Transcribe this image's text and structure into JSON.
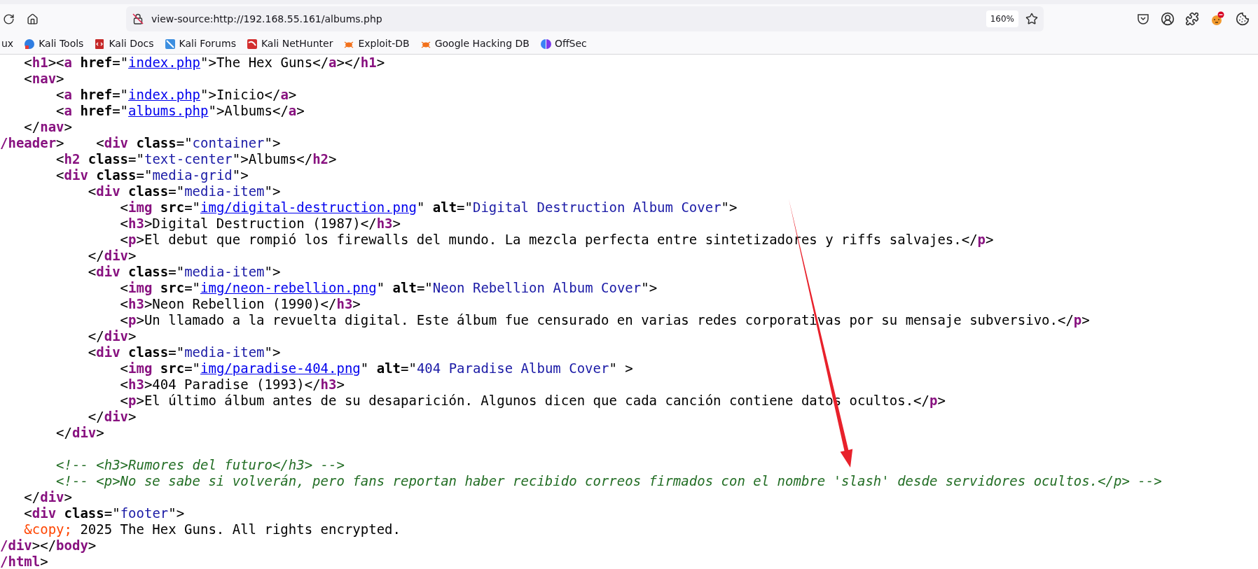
{
  "toolbar": {
    "url": "view-source:http://192.168.55.161/albums.php",
    "zoom": "160%"
  },
  "bookmarks": [
    {
      "label": "ux",
      "kind": "partial"
    },
    {
      "label": "Kali Tools",
      "kind": "site"
    },
    {
      "label": "Kali Docs",
      "kind": "site"
    },
    {
      "label": "Kali Forums",
      "kind": "site"
    },
    {
      "label": "Kali NetHunter",
      "kind": "site"
    },
    {
      "label": "Exploit-DB",
      "kind": "site"
    },
    {
      "label": "Google Hacking DB",
      "kind": "site"
    },
    {
      "label": "OffSec",
      "kind": "site"
    }
  ],
  "source": {
    "lines": [
      {
        "tokens": [
          {
            "kind": "plain",
            "text": "   <"
          },
          {
            "kind": "tag",
            "text": "h1"
          },
          {
            "kind": "plain",
            "text": "><"
          },
          {
            "kind": "tag",
            "text": "a"
          },
          {
            "kind": "attr",
            "text": " href"
          },
          {
            "kind": "plain",
            "text": "=\""
          },
          {
            "kind": "link",
            "text": "index.php"
          },
          {
            "kind": "plain",
            "text": "\">The Hex Guns</"
          },
          {
            "kind": "tag",
            "text": "a"
          },
          {
            "kind": "plain",
            "text": "></"
          },
          {
            "kind": "tag",
            "text": "h1"
          },
          {
            "kind": "plain",
            "text": ">"
          }
        ]
      },
      {
        "tokens": [
          {
            "kind": "plain",
            "text": "   <"
          },
          {
            "kind": "tag",
            "text": "nav"
          },
          {
            "kind": "plain",
            "text": ">"
          }
        ]
      },
      {
        "tokens": [
          {
            "kind": "plain",
            "text": "       <"
          },
          {
            "kind": "tag",
            "text": "a"
          },
          {
            "kind": "attr",
            "text": " href"
          },
          {
            "kind": "plain",
            "text": "=\""
          },
          {
            "kind": "link",
            "text": "index.php"
          },
          {
            "kind": "plain",
            "text": "\">Inicio</"
          },
          {
            "kind": "tag",
            "text": "a"
          },
          {
            "kind": "plain",
            "text": ">"
          }
        ]
      },
      {
        "tokens": [
          {
            "kind": "plain",
            "text": "       <"
          },
          {
            "kind": "tag",
            "text": "a"
          },
          {
            "kind": "attr",
            "text": " href"
          },
          {
            "kind": "plain",
            "text": "=\""
          },
          {
            "kind": "link",
            "text": "albums.php"
          },
          {
            "kind": "plain",
            "text": "\">Albums</"
          },
          {
            "kind": "tag",
            "text": "a"
          },
          {
            "kind": "plain",
            "text": ">"
          }
        ]
      },
      {
        "tokens": [
          {
            "kind": "plain",
            "text": "   </"
          },
          {
            "kind": "tag",
            "text": "nav"
          },
          {
            "kind": "plain",
            "text": ">"
          }
        ]
      },
      {
        "tokens": [
          {
            "kind": "tag",
            "text": "/header"
          },
          {
            "kind": "plain",
            "text": ">    <"
          },
          {
            "kind": "tag",
            "text": "div"
          },
          {
            "kind": "attr",
            "text": " class"
          },
          {
            "kind": "plain",
            "text": "=\""
          },
          {
            "kind": "value",
            "text": "container"
          },
          {
            "kind": "plain",
            "text": "\">"
          }
        ]
      },
      {
        "tokens": [
          {
            "kind": "plain",
            "text": "       <"
          },
          {
            "kind": "tag",
            "text": "h2"
          },
          {
            "kind": "attr",
            "text": " class"
          },
          {
            "kind": "plain",
            "text": "=\""
          },
          {
            "kind": "value",
            "text": "text-center"
          },
          {
            "kind": "plain",
            "text": "\">Albums</"
          },
          {
            "kind": "tag",
            "text": "h2"
          },
          {
            "kind": "plain",
            "text": ">"
          }
        ]
      },
      {
        "tokens": [
          {
            "kind": "plain",
            "text": "       <"
          },
          {
            "kind": "tag",
            "text": "div"
          },
          {
            "kind": "attr",
            "text": " class"
          },
          {
            "kind": "plain",
            "text": "=\""
          },
          {
            "kind": "value",
            "text": "media-grid"
          },
          {
            "kind": "plain",
            "text": "\">"
          }
        ]
      },
      {
        "tokens": [
          {
            "kind": "plain",
            "text": "           <"
          },
          {
            "kind": "tag",
            "text": "div"
          },
          {
            "kind": "attr",
            "text": " class"
          },
          {
            "kind": "plain",
            "text": "=\""
          },
          {
            "kind": "value",
            "text": "media-item"
          },
          {
            "kind": "plain",
            "text": "\">"
          }
        ]
      },
      {
        "tokens": [
          {
            "kind": "plain",
            "text": "               <"
          },
          {
            "kind": "tag",
            "text": "img"
          },
          {
            "kind": "attr",
            "text": " src"
          },
          {
            "kind": "plain",
            "text": "=\""
          },
          {
            "kind": "link",
            "text": "img/digital-destruction.png"
          },
          {
            "kind": "plain",
            "text": "\" "
          },
          {
            "kind": "attr",
            "text": "alt"
          },
          {
            "kind": "plain",
            "text": "=\""
          },
          {
            "kind": "value",
            "text": "Digital Destruction Album Cover"
          },
          {
            "kind": "plain",
            "text": "\">"
          }
        ]
      },
      {
        "tokens": [
          {
            "kind": "plain",
            "text": "               <"
          },
          {
            "kind": "tag",
            "text": "h3"
          },
          {
            "kind": "plain",
            "text": ">Digital Destruction (1987)</"
          },
          {
            "kind": "tag",
            "text": "h3"
          },
          {
            "kind": "plain",
            "text": ">"
          }
        ]
      },
      {
        "tokens": [
          {
            "kind": "plain",
            "text": "               <"
          },
          {
            "kind": "tag",
            "text": "p"
          },
          {
            "kind": "plain",
            "text": ">El debut que rompió los firewalls del mundo. La mezcla perfecta entre sintetizadores y riffs salvajes.</"
          },
          {
            "kind": "tag",
            "text": "p"
          },
          {
            "kind": "plain",
            "text": ">"
          }
        ]
      },
      {
        "tokens": [
          {
            "kind": "plain",
            "text": "           </"
          },
          {
            "kind": "tag",
            "text": "div"
          },
          {
            "kind": "plain",
            "text": ">"
          }
        ]
      },
      {
        "tokens": [
          {
            "kind": "plain",
            "text": "           <"
          },
          {
            "kind": "tag",
            "text": "div"
          },
          {
            "kind": "attr",
            "text": " class"
          },
          {
            "kind": "plain",
            "text": "=\""
          },
          {
            "kind": "value",
            "text": "media-item"
          },
          {
            "kind": "plain",
            "text": "\">"
          }
        ]
      },
      {
        "tokens": [
          {
            "kind": "plain",
            "text": "               <"
          },
          {
            "kind": "tag",
            "text": "img"
          },
          {
            "kind": "attr",
            "text": " src"
          },
          {
            "kind": "plain",
            "text": "=\""
          },
          {
            "kind": "link",
            "text": "img/neon-rebellion.png"
          },
          {
            "kind": "plain",
            "text": "\" "
          },
          {
            "kind": "attr",
            "text": "alt"
          },
          {
            "kind": "plain",
            "text": "=\""
          },
          {
            "kind": "value",
            "text": "Neon Rebellion Album Cover"
          },
          {
            "kind": "plain",
            "text": "\">"
          }
        ]
      },
      {
        "tokens": [
          {
            "kind": "plain",
            "text": "               <"
          },
          {
            "kind": "tag",
            "text": "h3"
          },
          {
            "kind": "plain",
            "text": ">Neon Rebellion (1990)</"
          },
          {
            "kind": "tag",
            "text": "h3"
          },
          {
            "kind": "plain",
            "text": ">"
          }
        ]
      },
      {
        "tokens": [
          {
            "kind": "plain",
            "text": "               <"
          },
          {
            "kind": "tag",
            "text": "p"
          },
          {
            "kind": "plain",
            "text": ">Un llamado a la revuelta digital. Este álbum fue censurado en varias redes corporativas por su mensaje subversivo.</"
          },
          {
            "kind": "tag",
            "text": "p"
          },
          {
            "kind": "plain",
            "text": ">"
          }
        ]
      },
      {
        "tokens": [
          {
            "kind": "plain",
            "text": "           </"
          },
          {
            "kind": "tag",
            "text": "div"
          },
          {
            "kind": "plain",
            "text": ">"
          }
        ]
      },
      {
        "tokens": [
          {
            "kind": "plain",
            "text": "           <"
          },
          {
            "kind": "tag",
            "text": "div"
          },
          {
            "kind": "attr",
            "text": " class"
          },
          {
            "kind": "plain",
            "text": "=\""
          },
          {
            "kind": "value",
            "text": "media-item"
          },
          {
            "kind": "plain",
            "text": "\">"
          }
        ]
      },
      {
        "tokens": [
          {
            "kind": "plain",
            "text": "               <"
          },
          {
            "kind": "tag",
            "text": "img"
          },
          {
            "kind": "attr",
            "text": " src"
          },
          {
            "kind": "plain",
            "text": "=\""
          },
          {
            "kind": "link",
            "text": "img/paradise-404.png"
          },
          {
            "kind": "plain",
            "text": "\" "
          },
          {
            "kind": "attr",
            "text": "alt"
          },
          {
            "kind": "plain",
            "text": "=\""
          },
          {
            "kind": "value",
            "text": "404 Paradise Album Cover"
          },
          {
            "kind": "plain",
            "text": "\" >"
          }
        ]
      },
      {
        "tokens": [
          {
            "kind": "plain",
            "text": "               <"
          },
          {
            "kind": "tag",
            "text": "h3"
          },
          {
            "kind": "plain",
            "text": ">404 Paradise (1993)</"
          },
          {
            "kind": "tag",
            "text": "h3"
          },
          {
            "kind": "plain",
            "text": ">"
          }
        ]
      },
      {
        "tokens": [
          {
            "kind": "plain",
            "text": "               <"
          },
          {
            "kind": "tag",
            "text": "p"
          },
          {
            "kind": "plain",
            "text": ">El último álbum antes de su desaparición. Algunos dicen que cada canción contiene datos ocultos.</"
          },
          {
            "kind": "tag",
            "text": "p"
          },
          {
            "kind": "plain",
            "text": ">"
          }
        ]
      },
      {
        "tokens": [
          {
            "kind": "plain",
            "text": "           </"
          },
          {
            "kind": "tag",
            "text": "div"
          },
          {
            "kind": "plain",
            "text": ">"
          }
        ]
      },
      {
        "tokens": [
          {
            "kind": "plain",
            "text": "       </"
          },
          {
            "kind": "tag",
            "text": "div"
          },
          {
            "kind": "plain",
            "text": ">"
          }
        ]
      },
      {
        "blank_line_before": true,
        "tokens": [
          {
            "kind": "comment",
            "text": "       <!-- <h3>Rumores del futuro</h3> -->"
          }
        ]
      },
      {
        "tokens": [
          {
            "kind": "comment",
            "text": "       <!-- <p>No se sabe si volverán, pero fans reportan haber recibido correos firmados con el nombre 'slash' desde servidores ocultos.</p> -->"
          }
        ]
      },
      {
        "tokens": [
          {
            "kind": "plain",
            "text": "   </"
          },
          {
            "kind": "tag",
            "text": "div"
          },
          {
            "kind": "plain",
            "text": ">"
          }
        ]
      },
      {
        "tokens": [
          {
            "kind": "plain",
            "text": "   <"
          },
          {
            "kind": "tag",
            "text": "div"
          },
          {
            "kind": "attr",
            "text": " class"
          },
          {
            "kind": "plain",
            "text": "=\""
          },
          {
            "kind": "value",
            "text": "footer"
          },
          {
            "kind": "plain",
            "text": "\">"
          }
        ]
      },
      {
        "tokens": [
          {
            "kind": "entity",
            "text": "   &copy;"
          },
          {
            "kind": "plain",
            "text": " 2025 The Hex Guns. All rights encrypted."
          }
        ]
      },
      {
        "tokens": [
          {
            "kind": "tag",
            "text": "/div"
          },
          {
            "kind": "plain",
            "text": "></"
          },
          {
            "kind": "tag",
            "text": "body"
          },
          {
            "kind": "plain",
            "text": ">"
          }
        ]
      },
      {
        "tokens": [
          {
            "kind": "tag",
            "text": "/html"
          },
          {
            "kind": "plain",
            "text": ">"
          }
        ]
      }
    ]
  }
}
